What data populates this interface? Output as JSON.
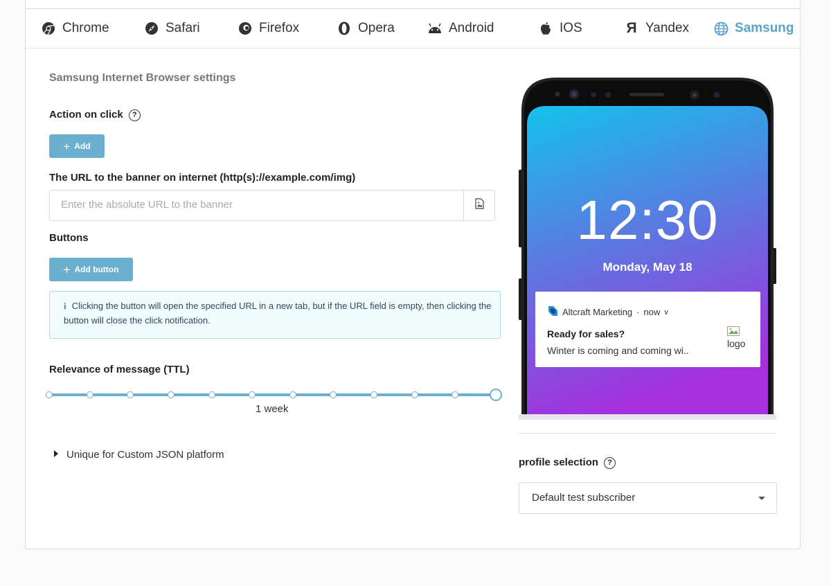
{
  "tabs": [
    {
      "label": "Chrome",
      "icon": "chrome-icon"
    },
    {
      "label": "Safari",
      "icon": "compass-icon"
    },
    {
      "label": "Firefox",
      "icon": "firefox-icon"
    },
    {
      "label": "Opera",
      "icon": "opera-icon"
    },
    {
      "label": "Android",
      "icon": "android-icon"
    },
    {
      "label": "IOS",
      "icon": "apple-icon"
    },
    {
      "label": "Yandex",
      "icon": "yandex-icon"
    },
    {
      "label": "Samsung",
      "icon": "globe-icon",
      "active": true
    }
  ],
  "settings": {
    "title": "Samsung Internet Browser settings",
    "action_label": "Action on click",
    "help_glyph": "?",
    "add_label": "Add",
    "url_label": "The URL to the banner on internet (http(s)://example.com/img)",
    "url_placeholder": "Enter the absolute URL to the banner",
    "url_value": "",
    "buttons_label": "Buttons",
    "add_button_label": "Add button",
    "info_glyph": "i",
    "info_text": "Clicking the button will open the specified URL in a new tab, but if the URL field is empty, then clicking the button will close the click notification.",
    "ttl_label": "Relevance of message (TTL)",
    "ttl_value": "1 week",
    "ttl_steps": 12,
    "ttl_selected_index": 11,
    "custom_json_label": "Unique for Custom JSON platform"
  },
  "preview": {
    "time": "12:30",
    "date": "Monday, May 18",
    "app_name": "Altcraft Marketing",
    "when": "now",
    "expand_glyph": "v",
    "notif_title": "Ready for sales?",
    "notif_body": "Winter is coming and coming wi..",
    "logo_alt": "logo"
  },
  "profile": {
    "label": "profile selection",
    "selected": "Default test subscriber"
  },
  "colors": {
    "accent": "#6aaed0",
    "active_tab": "#5ba3c9",
    "info_bg": "#f2fbfc"
  }
}
